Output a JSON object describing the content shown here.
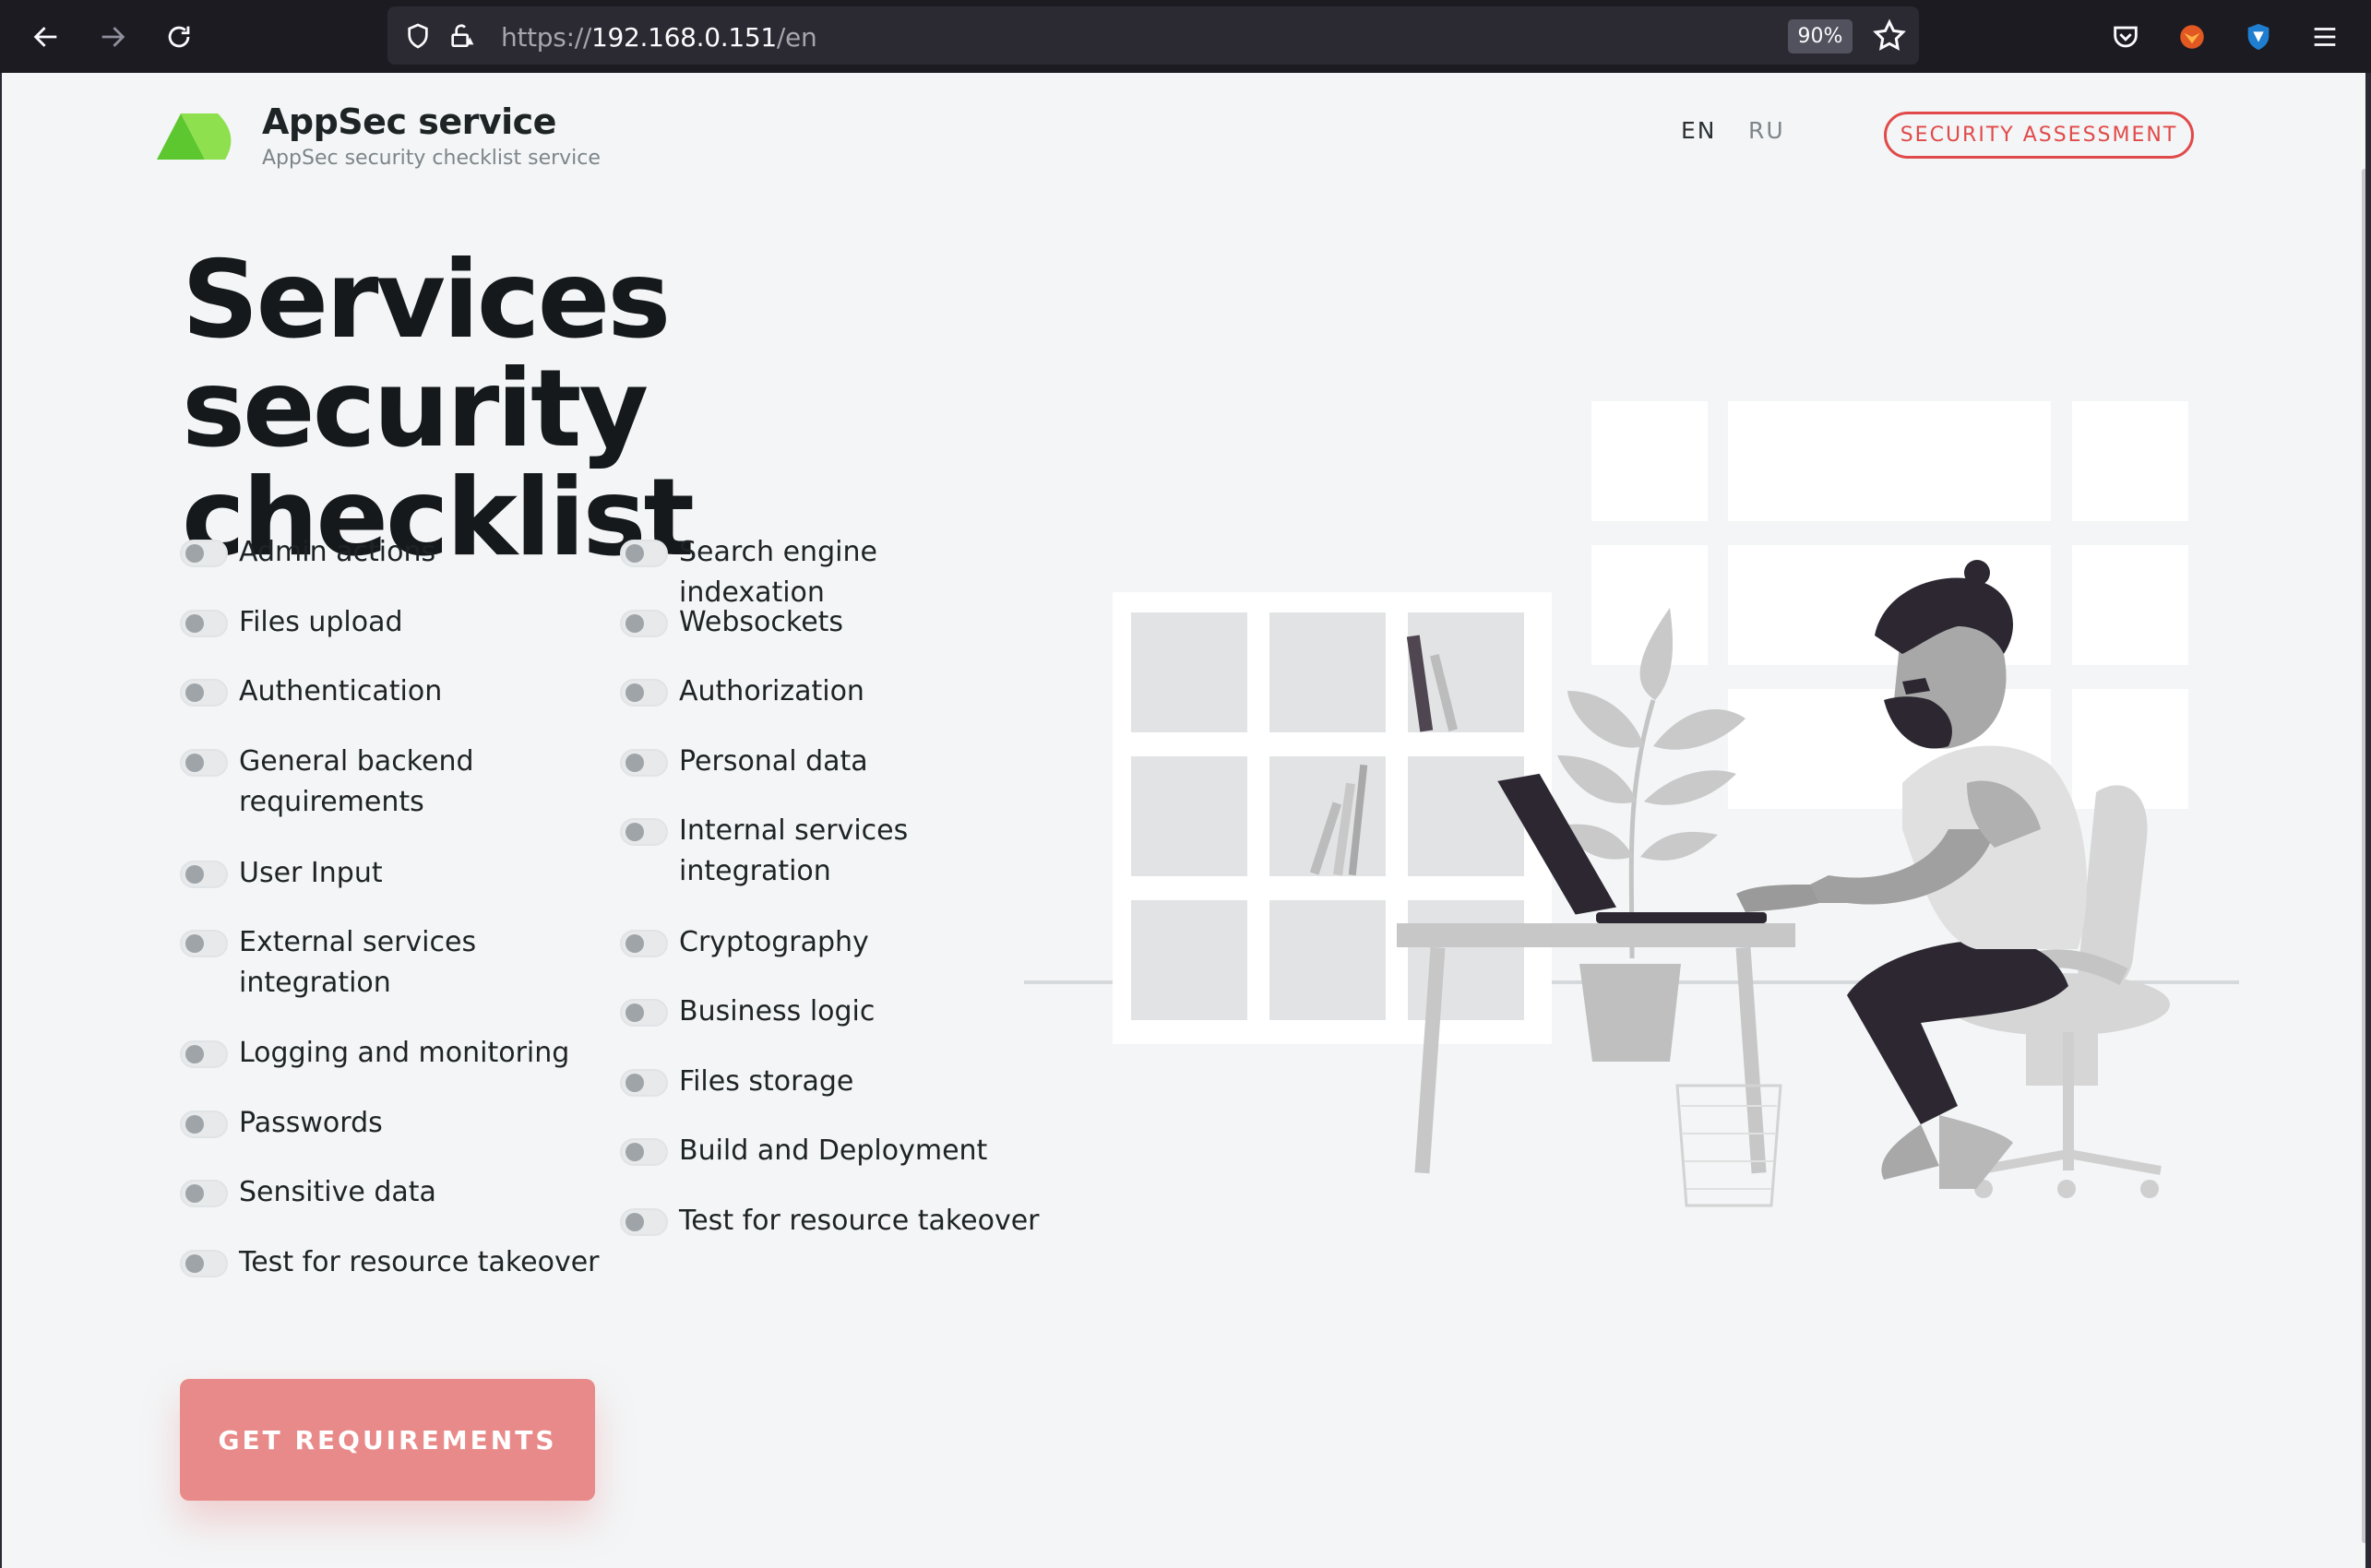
{
  "browser": {
    "url_scheme": "https://",
    "url_host": "192.168.0.151",
    "url_path": "/en",
    "zoom": "90%"
  },
  "header": {
    "brand_title": "AppSec service",
    "brand_subtitle": "AppSec security checklist service",
    "lang_en": "EN",
    "lang_ru": "RU",
    "assessment_button": "SECURITY ASSESSMENT",
    "accent_color": "#e14a4a",
    "logo_color": "#6cd33a"
  },
  "main": {
    "title_line1": "Services security",
    "title_line2": "checklist",
    "left_options": [
      "Admin actions",
      "Files upload",
      "Authentication",
      "General backend requirements",
      "User Input",
      "External services integration",
      "Logging and monitoring",
      "Passwords",
      "Sensitive data",
      "Test for resource takeover"
    ],
    "right_options": [
      "Search engine indexation",
      "Websockets",
      "Authorization",
      "Personal data",
      "Internal services integration",
      "Cryptography",
      "Business logic",
      "Files storage",
      "Build and Deployment",
      "Test for resource takeover"
    ],
    "submit_button": "GET REQUIREMENTS"
  }
}
